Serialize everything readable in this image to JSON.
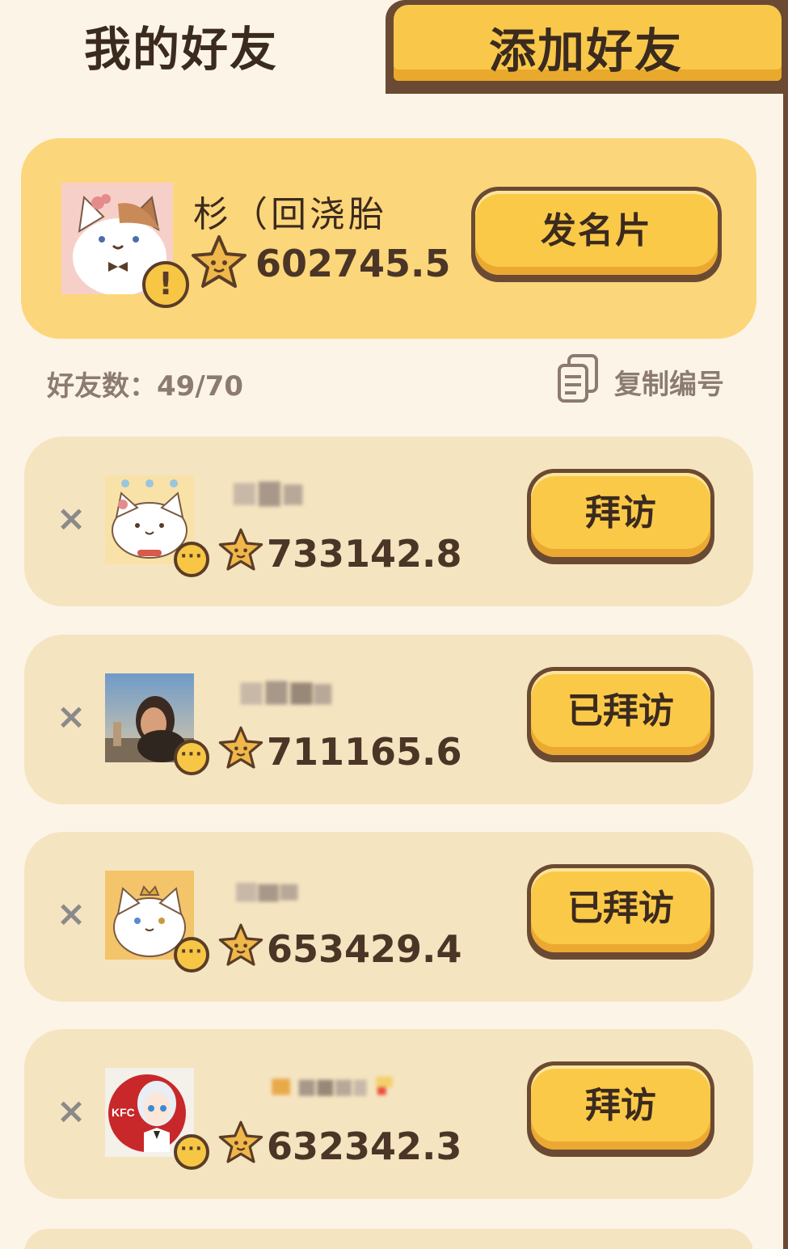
{
  "tabs": {
    "my_friends": "我的好友",
    "add_friend": "添加好友"
  },
  "self": {
    "name": "杉（回浇胎",
    "score": "602745.5",
    "badge": "!",
    "card_button": "发名片"
  },
  "info": {
    "friend_count": "好友数：49/70",
    "copy_id": "复制编号"
  },
  "friends": [
    {
      "remove": "×",
      "score": "733142.8",
      "button": "拜访",
      "badge": "···"
    },
    {
      "remove": "×",
      "score": "711165.6",
      "button": "已拜访",
      "badge": "···"
    },
    {
      "remove": "×",
      "score": "653429.4",
      "button": "已拜访",
      "badge": "···"
    },
    {
      "remove": "×",
      "score": "632342.3",
      "button": "拜访",
      "badge": "···"
    }
  ],
  "icons": {
    "star": "star-icon",
    "copy": "copy-icon",
    "remove": "close-icon",
    "more": "more-icon"
  },
  "colors": {
    "accent_yellow": "#fbc948",
    "card_yellow": "#fcd67a",
    "row_beige": "#f5e4c0",
    "border_brown": "#6b4a34",
    "background": "#fdf4e8"
  }
}
